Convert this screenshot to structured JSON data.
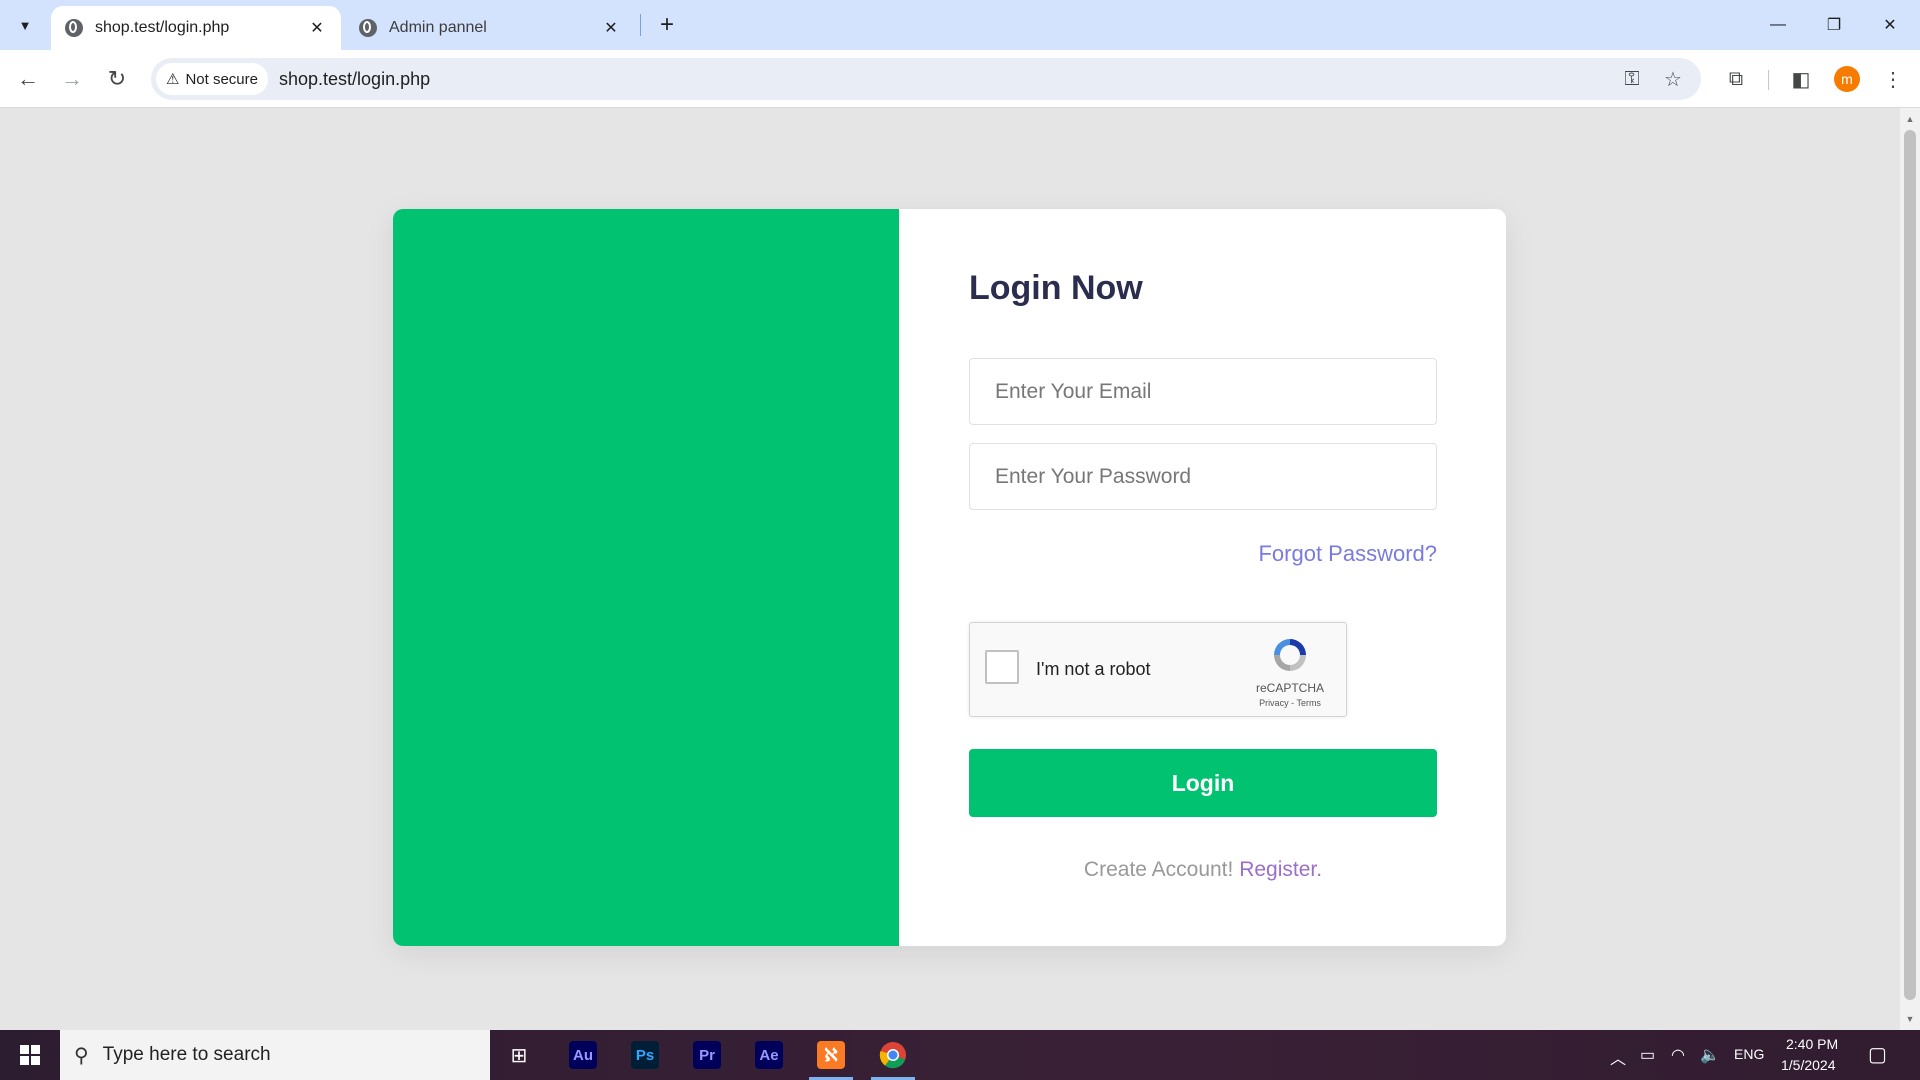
{
  "browser": {
    "tabs": [
      {
        "title": "shop.test/login.php",
        "active": true
      },
      {
        "title": "Admin pannel",
        "active": false
      }
    ],
    "security_label": "Not secure",
    "url": "shop.test/login.php",
    "profile_initial": "m",
    "icons": {
      "back": "arrow-left-icon",
      "forward": "arrow-right-icon",
      "reload": "reload-icon",
      "password": "key-icon",
      "bookmark": "star-icon",
      "extensions": "puzzle-icon",
      "sidepanel": "side-panel-icon",
      "menu": "kebab-menu-icon"
    }
  },
  "login": {
    "title": "Login Now",
    "email_placeholder": "Enter Your Email",
    "password_placeholder": "Enter Your Password",
    "forgot_label": "Forgot Password?",
    "recaptcha": {
      "label": "I'm not a robot",
      "brand": "reCAPTCHA",
      "privacy": "Privacy",
      "separator": "-",
      "terms": "Terms"
    },
    "button_label": "Login",
    "create_account_text": "Create Account!",
    "register_link": "Register."
  },
  "colors": {
    "accent_green": "#00c271",
    "title_navy": "#2b2d4e",
    "link_blue": "#7a7ae0",
    "link_purple": "#9b6fc9"
  },
  "taskbar": {
    "search_placeholder": "Type here to search",
    "apps": [
      {
        "name": "Task View",
        "icon": "task-view-icon"
      },
      {
        "name": "Audition",
        "badge": "Au"
      },
      {
        "name": "Photoshop",
        "badge": "Ps"
      },
      {
        "name": "Premiere Pro",
        "badge": "Pr"
      },
      {
        "name": "After Effects",
        "badge": "Ae"
      },
      {
        "name": "XAMPP",
        "icon": "xampp-icon"
      },
      {
        "name": "Chrome",
        "icon": "chrome-icon"
      }
    ],
    "language": "ENG",
    "time": "2:40 PM",
    "date": "1/5/2024"
  }
}
